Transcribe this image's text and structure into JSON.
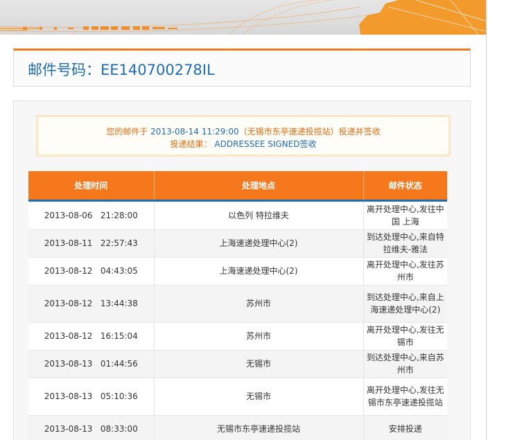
{
  "banner": {
    "icons": [
      "plane-icon",
      "truck-icon",
      "train-icon",
      "ship-icon",
      "map-icon"
    ]
  },
  "header": {
    "title": "邮件号码：EE140700278IL"
  },
  "notice": {
    "line1_prefix": "您的邮件于 ",
    "line1_datetime": "2013-08-14 11:29:00",
    "line1_place": "（无锡市东亭速递投揽站）",
    "line1_suffix": "投递并签收",
    "line2_label": "投递结果：",
    "line2_value": "ADDRESSEE SIGNED",
    "line2_suffix": "签收"
  },
  "table": {
    "headers": [
      "处理时间",
      "处理地点",
      "邮件状态"
    ],
    "rows": [
      {
        "time": "2013-08-06   21:28:00",
        "place": "以色列 特拉维夫",
        "status": "离开处理中心,发往中国 上海"
      },
      {
        "time": "2013-08-11   22:57:43",
        "place": "上海速递处理中心(2)",
        "status": "到达处理中心,来自特拉维夫-雅法"
      },
      {
        "time": "2013-08-12   04:43:05",
        "place": "上海速递处理中心(2)",
        "status": "离开处理中心,发往苏州市"
      },
      {
        "time": "2013-08-12   13:44:38",
        "place": "苏州市",
        "status": "到达处理中心,来自上海速递处理中心(2)"
      },
      {
        "time": "2013-08-12   16:15:04",
        "place": "苏州市",
        "status": "离开处理中心,发往无锡市"
      },
      {
        "time": "2013-08-13   01:44:56",
        "place": "无锡市",
        "status": "到达处理中心,来自苏州市"
      },
      {
        "time": "2013-08-13   05:10:36",
        "place": "无锡市",
        "status": "离开处理中心,发往无锡市东亭速递投揽站"
      },
      {
        "time": "2013-08-13   08:33:00",
        "place": "无锡市东亭速递投揽站",
        "status": "安排投递"
      }
    ]
  }
}
